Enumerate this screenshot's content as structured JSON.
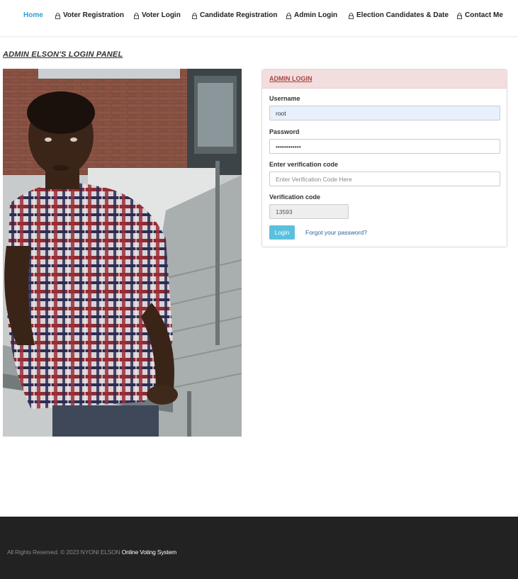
{
  "nav": {
    "items": [
      {
        "label": "Home",
        "icon": "",
        "active": true
      },
      {
        "label": "Voter Registration",
        "icon": "lock-icon"
      },
      {
        "label": "Voter Login",
        "icon": "lock-icon"
      },
      {
        "label": "Candidate Registration",
        "icon": "lock-icon"
      },
      {
        "label": "Admin Login",
        "icon": "lock-icon"
      },
      {
        "label": "Election Candidates & Date",
        "icon": "lock-icon"
      },
      {
        "label": "Contact Me",
        "icon": "lock-icon"
      }
    ],
    "active_color": "#2a9fd6"
  },
  "page": {
    "title": "ADMIN ELSON'S LOGIN PANEL"
  },
  "login": {
    "panel_title": "ADMIN LOGIN",
    "username_label": "Username",
    "username_value": "root",
    "password_label": "Password",
    "password_value": "••••••••••••",
    "verify_label": "Enter verification code",
    "verify_placeholder": "Enter Verification Code Here",
    "code_label": "Verification code",
    "code_value": "13593",
    "login_button": "Login",
    "forgot_link": "Forgot your password?",
    "header_bg": "#f2dede",
    "header_text_color": "#a94442",
    "button_color": "#5bc0de"
  },
  "footer": {
    "text": "All Rights Reserved. © 2023 NYONI ELSON",
    "brand": "Online Voting System",
    "bg": "#222222"
  }
}
